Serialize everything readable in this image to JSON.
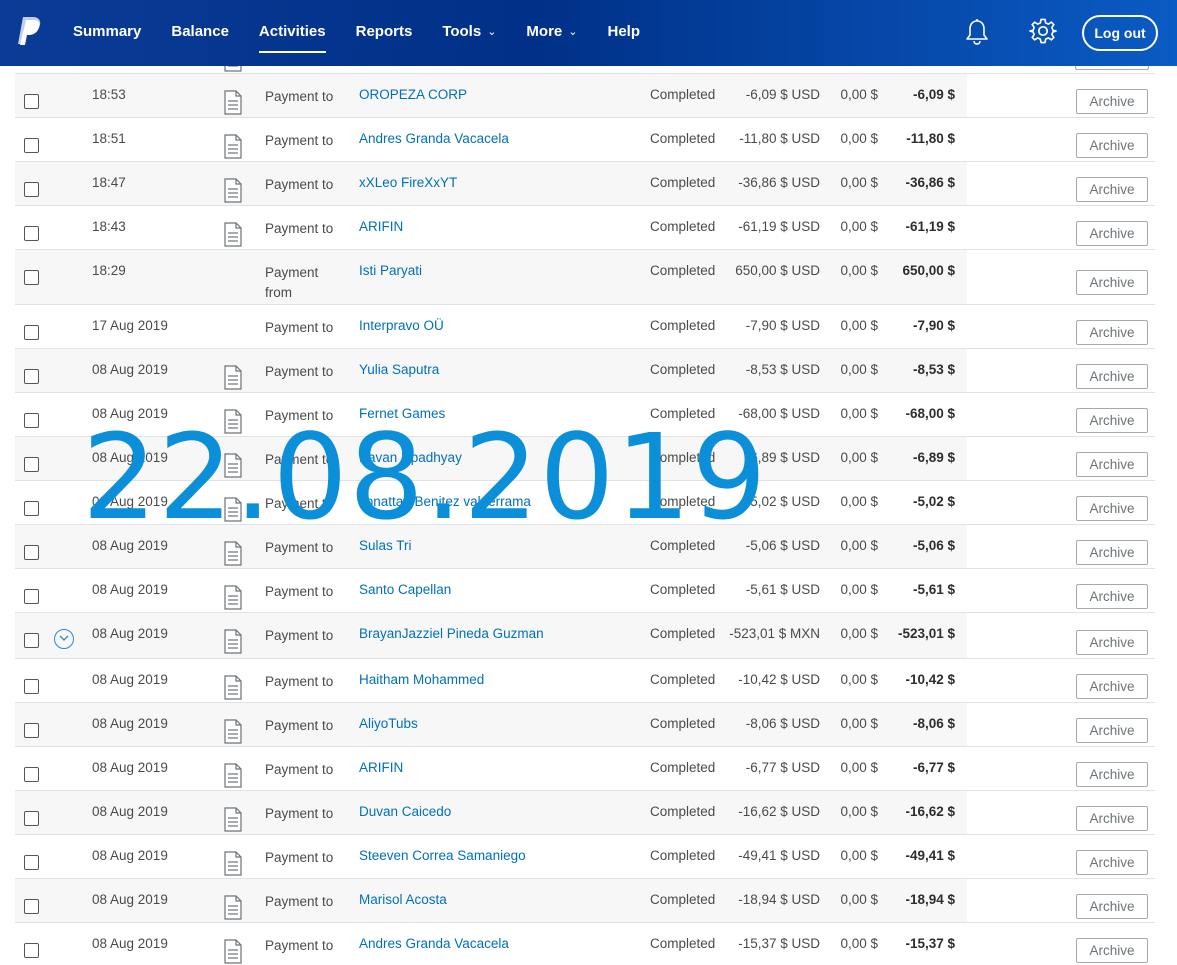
{
  "header": {
    "nav": [
      {
        "label": "Summary",
        "active": false,
        "has_dropdown": false
      },
      {
        "label": "Balance",
        "active": false,
        "has_dropdown": false
      },
      {
        "label": "Activities",
        "active": true,
        "has_dropdown": false
      },
      {
        "label": "Reports",
        "active": false,
        "has_dropdown": false
      },
      {
        "label": "Tools",
        "active": false,
        "has_dropdown": true
      },
      {
        "label": "More",
        "active": false,
        "has_dropdown": true
      },
      {
        "label": "Help",
        "active": false,
        "has_dropdown": false
      }
    ],
    "logout_label": "Log out",
    "icons": [
      "paypal-logo",
      "bell-icon",
      "gear-icon"
    ],
    "brand_color": "#003087"
  },
  "watermark": "22.08.2019",
  "archive_label": "Archive",
  "transactions": [
    {
      "date": "18:53",
      "doc": true,
      "type": "Payment to",
      "name": "OROPEZA CORP",
      "status": "Completed",
      "gross": "-6,09 $ USD",
      "fee": "0,00 $",
      "net": "-6,09 $"
    },
    {
      "date": "18:51",
      "doc": true,
      "type": "Payment to",
      "name": "Andres Granda Vacacela",
      "status": "Completed",
      "gross": "-11,80 $ USD",
      "fee": "0,00 $",
      "net": "-11,80 $"
    },
    {
      "date": "18:47",
      "doc": true,
      "type": "Payment to",
      "name": "xXLeo FireXxYT",
      "status": "Completed",
      "gross": "-36,86 $ USD",
      "fee": "0,00 $",
      "net": "-36,86 $"
    },
    {
      "date": "18:43",
      "doc": true,
      "type": "Payment to",
      "name": "ARIFIN",
      "status": "Completed",
      "gross": "-61,19 $ USD",
      "fee": "0,00 $",
      "net": "-61,19 $"
    },
    {
      "date": "18:29",
      "doc": false,
      "type": "Payment from",
      "name": "Isti Paryati",
      "status": "Completed",
      "gross": "650,00 $ USD",
      "fee": "0,00 $",
      "net": "650,00 $"
    },
    {
      "date": "17 Aug 2019",
      "doc": false,
      "type": "Payment to",
      "name": "Interpravo OÜ",
      "status": "Completed",
      "gross": "-7,90 $ USD",
      "fee": "0,00 $",
      "net": "-7,90 $"
    },
    {
      "date": "08 Aug 2019",
      "doc": true,
      "type": "Payment to",
      "name": "Yulia Saputra",
      "status": "Completed",
      "gross": "-8,53 $ USD",
      "fee": "0,00 $",
      "net": "-8,53 $"
    },
    {
      "date": "08 Aug 2019",
      "doc": true,
      "type": "Payment to",
      "name": "Fernet Games",
      "status": "Completed",
      "gross": "-68,00 $ USD",
      "fee": "0,00 $",
      "net": "-68,00 $"
    },
    {
      "date": "08 Aug 2019",
      "doc": true,
      "type": "Payment to",
      "name": "Pavan Upadhyay",
      "status": "Completed",
      "gross": "-6,89 $ USD",
      "fee": "0,00 $",
      "net": "-6,89 $"
    },
    {
      "date": "08 Aug 2019",
      "doc": true,
      "type": "Payment to",
      "name": "Jonattan Benitez valderrama",
      "status": "Completed",
      "gross": "-5,02 $ USD",
      "fee": "0,00 $",
      "net": "-5,02 $"
    },
    {
      "date": "08 Aug 2019",
      "doc": true,
      "type": "Payment to",
      "name": "Sulas Tri",
      "status": "Completed",
      "gross": "-5,06 $ USD",
      "fee": "0,00 $",
      "net": "-5,06 $"
    },
    {
      "date": "08 Aug 2019",
      "doc": true,
      "type": "Payment to",
      "name": "Santo Capellan",
      "status": "Completed",
      "gross": "-5,61 $ USD",
      "fee": "0,00 $",
      "net": "-5,61 $"
    },
    {
      "date": "08 Aug 2019",
      "doc": true,
      "expand": true,
      "type": "Payment to",
      "name": "BrayanJazziel Pineda Guzman",
      "status": "Completed",
      "gross": "-523,01 $ MXN",
      "fee": "0,00 $",
      "net": "-523,01 $"
    },
    {
      "date": "08 Aug 2019",
      "doc": true,
      "type": "Payment to",
      "name": "Haitham Mohammed",
      "status": "Completed",
      "gross": "-10,42 $ USD",
      "fee": "0,00 $",
      "net": "-10,42 $"
    },
    {
      "date": "08 Aug 2019",
      "doc": true,
      "type": "Payment to",
      "name": "AliyoTubs",
      "status": "Completed",
      "gross": "-8,06 $ USD",
      "fee": "0,00 $",
      "net": "-8,06 $"
    },
    {
      "date": "08 Aug 2019",
      "doc": true,
      "type": "Payment to",
      "name": "ARIFIN",
      "status": "Completed",
      "gross": "-6,77 $ USD",
      "fee": "0,00 $",
      "net": "-6,77 $"
    },
    {
      "date": "08 Aug 2019",
      "doc": true,
      "type": "Payment to",
      "name": "Duvan Caicedo",
      "status": "Completed",
      "gross": "-16,62 $ USD",
      "fee": "0,00 $",
      "net": "-16,62 $"
    },
    {
      "date": "08 Aug 2019",
      "doc": true,
      "type": "Payment to",
      "name": "Steeven Correa Samaniego",
      "status": "Completed",
      "gross": "-49,41 $ USD",
      "fee": "0,00 $",
      "net": "-49,41 $"
    },
    {
      "date": "08 Aug 2019",
      "doc": true,
      "type": "Payment to",
      "name": "Marisol Acosta",
      "status": "Completed",
      "gross": "-18,94 $ USD",
      "fee": "0,00 $",
      "net": "-18,94 $"
    },
    {
      "date": "08 Aug 2019",
      "doc": true,
      "type": "Payment to",
      "name": "Andres Granda Vacacela",
      "status": "Completed",
      "gross": "-15,37 $ USD",
      "fee": "0,00 $",
      "net": "-15,37 $"
    }
  ]
}
